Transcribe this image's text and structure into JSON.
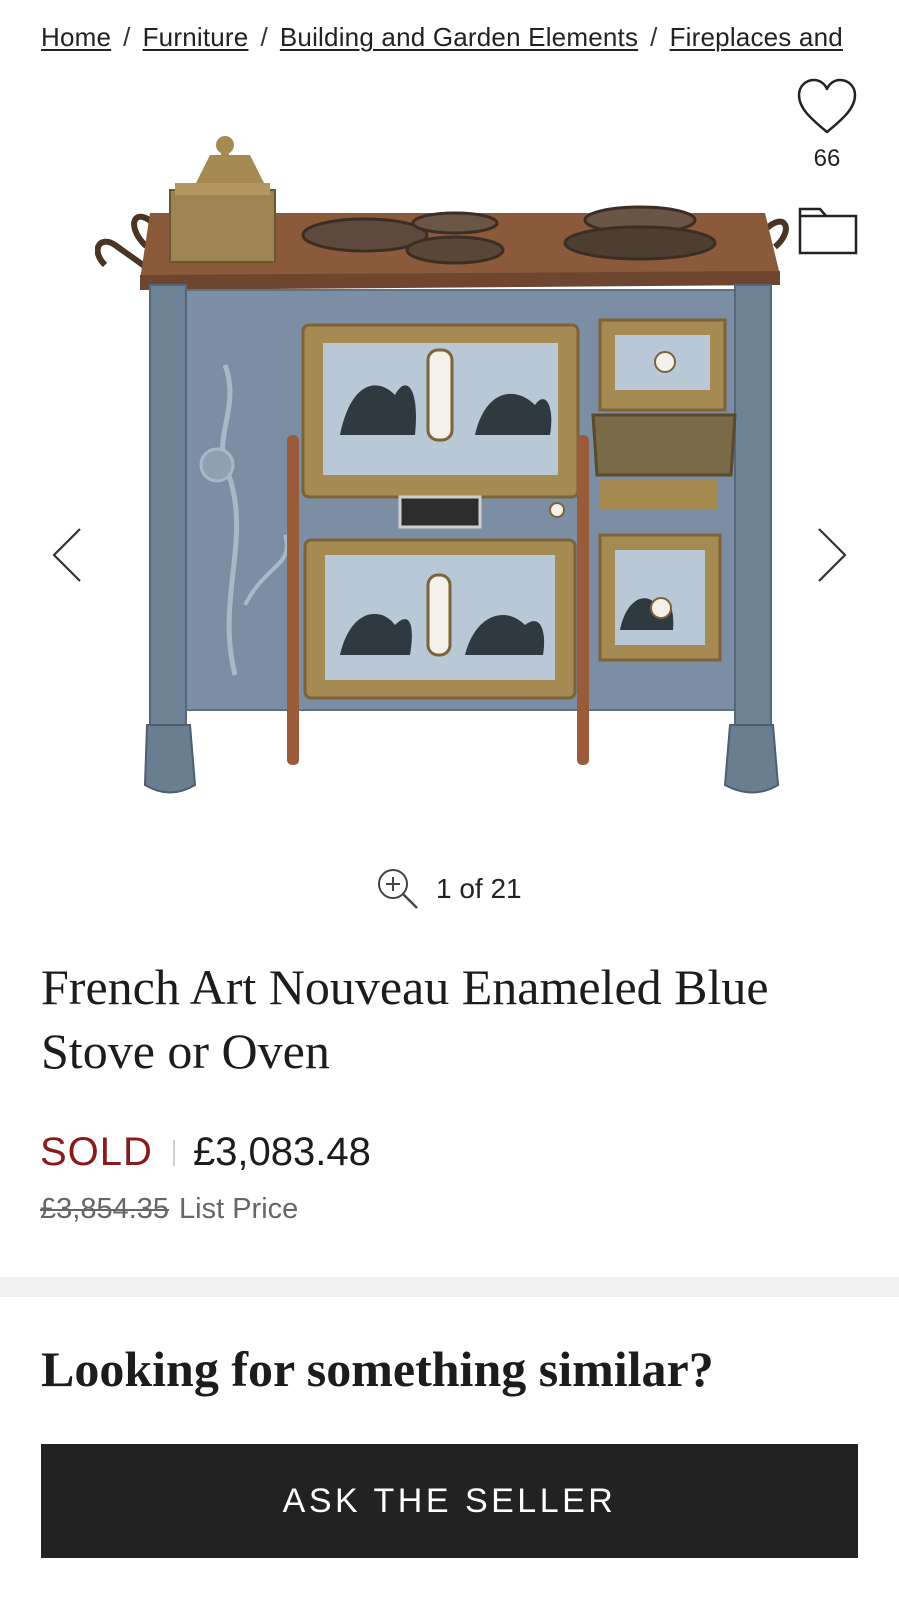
{
  "breadcrumb": {
    "items": [
      "Home",
      "Furniture",
      "Building and Garden Elements",
      "Fireplaces and"
    ],
    "separator": "/"
  },
  "favorites": {
    "count": "66",
    "icon": "heart-outline-icon"
  },
  "folder": {
    "icon": "folder-outline-icon"
  },
  "gallery": {
    "counter": "1 of 21",
    "zoom_icon": "zoom-in-icon",
    "prev_icon": "chevron-left-icon",
    "next_icon": "chevron-right-icon"
  },
  "product": {
    "title": "French Art Nouveau Enameled Blue Stove or Oven",
    "status": "SOLD",
    "price": "£3,083.48",
    "list_price_old": "£3,854.35",
    "list_price_label": "List Price"
  },
  "similar": {
    "heading": "Looking for something similar?",
    "button_label": "ASK THE SELLER"
  },
  "colors": {
    "sold": "#8b1a1a",
    "button_bg": "#222222",
    "band": "#f1f1f1",
    "enamel_blue": "#7b8ea3",
    "copper_top": "#8a5a3a",
    "brass": "#a58a52"
  }
}
